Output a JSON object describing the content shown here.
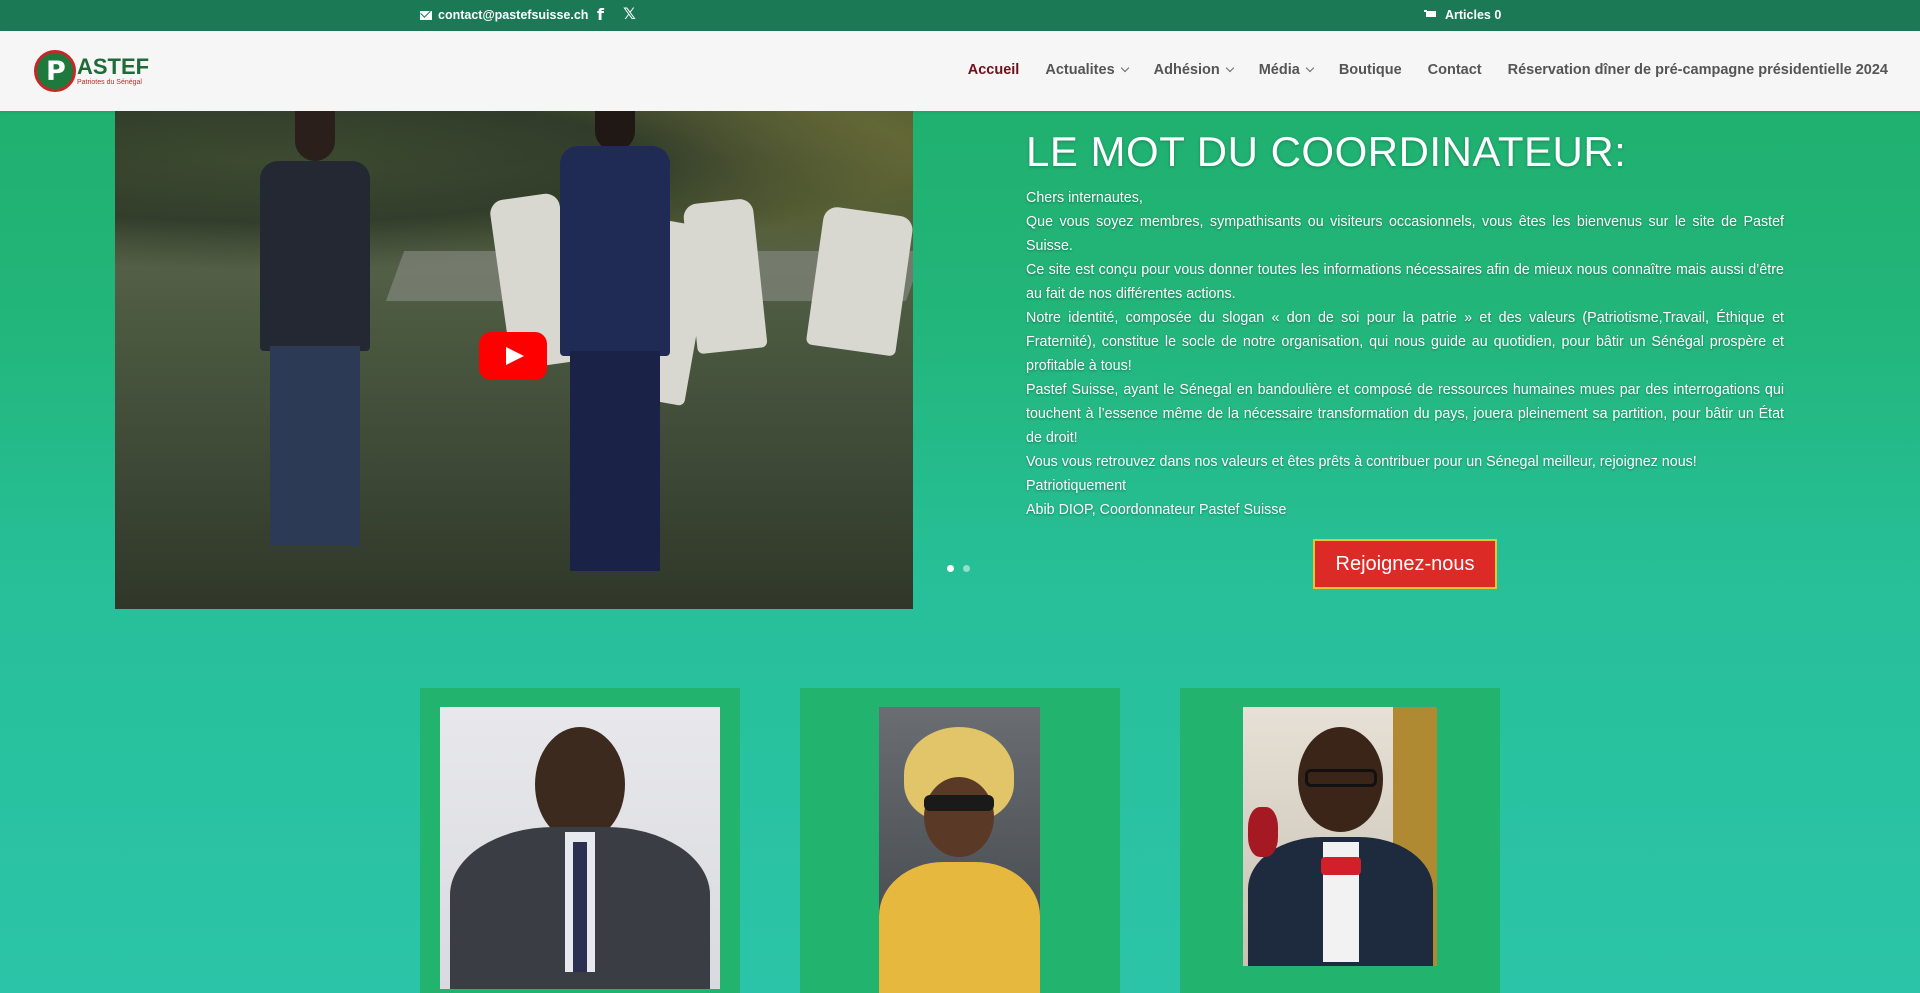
{
  "topbar": {
    "email": "contact@pastefsuisse.ch",
    "facebook_icon": "f",
    "x_icon": "𝕏",
    "cart_label": "Articles 0"
  },
  "logo": {
    "brand": "ASTEF",
    "tagline": "Patriotes du Sénégal"
  },
  "nav": [
    {
      "label": "Accueil",
      "active": true
    },
    {
      "label": "Actualites",
      "dropdown": true
    },
    {
      "label": "Adhésion",
      "dropdown": true
    },
    {
      "label": "Média",
      "dropdown": true
    },
    {
      "label": "Boutique"
    },
    {
      "label": "Contact"
    },
    {
      "label": "Réservation dîner de pré-campagne présidentielle 2024"
    }
  ],
  "hero": {
    "title": "LE MOT DU COORDINATEUR:",
    "paragraphs": [
      "Chers internautes,",
      "Que vous soyez membres, sympathisants ou visiteurs occasionnels, vous êtes les bienvenus sur le site de Pastef Suisse.",
      "Ce site est conçu pour vous donner toutes les informations nécessaires afin de mieux nous connaître mais aussi d’être au fait de nos différentes actions.",
      "Notre identité, composée du slogan « don de soi pour la patrie » et des valeurs (Patriotisme,Travail, Éthique et Fraternité), constitue le socle de notre organisation, qui nous guide au quotidien, pour bâtir un Sénégal prospère et profitable à tous!",
      "Pastef Suisse, ayant le Sénegal en bandoulière et composé de ressources humaines mues par des interrogations qui touchent à l’essence même de la nécessaire transformation du pays, jouera pleinement sa partition, pour bâtir un État de droit!",
      "Vous vous retrouvez dans nos valeurs et êtes prêts à contribuer pour un Sénegal meilleur, rejoignez nous!",
      "Patriotiquement",
      "Abib DIOP, Coordonnateur Pastef Suisse"
    ],
    "join_button": "Rejoignez-nous",
    "slide_count": 2,
    "active_slide": 1
  },
  "colors": {
    "topbar": "#1b7a55",
    "accent_red": "#dc2a26",
    "nav_active": "#6e0f1c",
    "card_bg": "#22b46f"
  }
}
